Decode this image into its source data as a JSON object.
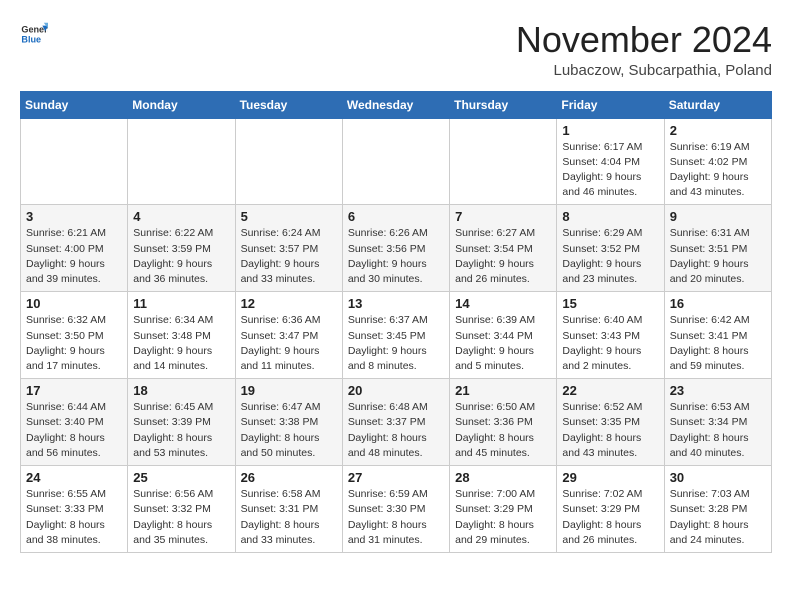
{
  "header": {
    "logo_general": "General",
    "logo_blue": "Blue",
    "month_title": "November 2024",
    "location": "Lubaczow, Subcarpathia, Poland"
  },
  "weekdays": [
    "Sunday",
    "Monday",
    "Tuesday",
    "Wednesday",
    "Thursday",
    "Friday",
    "Saturday"
  ],
  "weeks": [
    [
      {
        "day": "",
        "detail": ""
      },
      {
        "day": "",
        "detail": ""
      },
      {
        "day": "",
        "detail": ""
      },
      {
        "day": "",
        "detail": ""
      },
      {
        "day": "",
        "detail": ""
      },
      {
        "day": "1",
        "detail": "Sunrise: 6:17 AM\nSunset: 4:04 PM\nDaylight: 9 hours\nand 46 minutes."
      },
      {
        "day": "2",
        "detail": "Sunrise: 6:19 AM\nSunset: 4:02 PM\nDaylight: 9 hours\nand 43 minutes."
      }
    ],
    [
      {
        "day": "3",
        "detail": "Sunrise: 6:21 AM\nSunset: 4:00 PM\nDaylight: 9 hours\nand 39 minutes."
      },
      {
        "day": "4",
        "detail": "Sunrise: 6:22 AM\nSunset: 3:59 PM\nDaylight: 9 hours\nand 36 minutes."
      },
      {
        "day": "5",
        "detail": "Sunrise: 6:24 AM\nSunset: 3:57 PM\nDaylight: 9 hours\nand 33 minutes."
      },
      {
        "day": "6",
        "detail": "Sunrise: 6:26 AM\nSunset: 3:56 PM\nDaylight: 9 hours\nand 30 minutes."
      },
      {
        "day": "7",
        "detail": "Sunrise: 6:27 AM\nSunset: 3:54 PM\nDaylight: 9 hours\nand 26 minutes."
      },
      {
        "day": "8",
        "detail": "Sunrise: 6:29 AM\nSunset: 3:52 PM\nDaylight: 9 hours\nand 23 minutes."
      },
      {
        "day": "9",
        "detail": "Sunrise: 6:31 AM\nSunset: 3:51 PM\nDaylight: 9 hours\nand 20 minutes."
      }
    ],
    [
      {
        "day": "10",
        "detail": "Sunrise: 6:32 AM\nSunset: 3:50 PM\nDaylight: 9 hours\nand 17 minutes."
      },
      {
        "day": "11",
        "detail": "Sunrise: 6:34 AM\nSunset: 3:48 PM\nDaylight: 9 hours\nand 14 minutes."
      },
      {
        "day": "12",
        "detail": "Sunrise: 6:36 AM\nSunset: 3:47 PM\nDaylight: 9 hours\nand 11 minutes."
      },
      {
        "day": "13",
        "detail": "Sunrise: 6:37 AM\nSunset: 3:45 PM\nDaylight: 9 hours\nand 8 minutes."
      },
      {
        "day": "14",
        "detail": "Sunrise: 6:39 AM\nSunset: 3:44 PM\nDaylight: 9 hours\nand 5 minutes."
      },
      {
        "day": "15",
        "detail": "Sunrise: 6:40 AM\nSunset: 3:43 PM\nDaylight: 9 hours\nand 2 minutes."
      },
      {
        "day": "16",
        "detail": "Sunrise: 6:42 AM\nSunset: 3:41 PM\nDaylight: 8 hours\nand 59 minutes."
      }
    ],
    [
      {
        "day": "17",
        "detail": "Sunrise: 6:44 AM\nSunset: 3:40 PM\nDaylight: 8 hours\nand 56 minutes."
      },
      {
        "day": "18",
        "detail": "Sunrise: 6:45 AM\nSunset: 3:39 PM\nDaylight: 8 hours\nand 53 minutes."
      },
      {
        "day": "19",
        "detail": "Sunrise: 6:47 AM\nSunset: 3:38 PM\nDaylight: 8 hours\nand 50 minutes."
      },
      {
        "day": "20",
        "detail": "Sunrise: 6:48 AM\nSunset: 3:37 PM\nDaylight: 8 hours\nand 48 minutes."
      },
      {
        "day": "21",
        "detail": "Sunrise: 6:50 AM\nSunset: 3:36 PM\nDaylight: 8 hours\nand 45 minutes."
      },
      {
        "day": "22",
        "detail": "Sunrise: 6:52 AM\nSunset: 3:35 PM\nDaylight: 8 hours\nand 43 minutes."
      },
      {
        "day": "23",
        "detail": "Sunrise: 6:53 AM\nSunset: 3:34 PM\nDaylight: 8 hours\nand 40 minutes."
      }
    ],
    [
      {
        "day": "24",
        "detail": "Sunrise: 6:55 AM\nSunset: 3:33 PM\nDaylight: 8 hours\nand 38 minutes."
      },
      {
        "day": "25",
        "detail": "Sunrise: 6:56 AM\nSunset: 3:32 PM\nDaylight: 8 hours\nand 35 minutes."
      },
      {
        "day": "26",
        "detail": "Sunrise: 6:58 AM\nSunset: 3:31 PM\nDaylight: 8 hours\nand 33 minutes."
      },
      {
        "day": "27",
        "detail": "Sunrise: 6:59 AM\nSunset: 3:30 PM\nDaylight: 8 hours\nand 31 minutes."
      },
      {
        "day": "28",
        "detail": "Sunrise: 7:00 AM\nSunset: 3:29 PM\nDaylight: 8 hours\nand 29 minutes."
      },
      {
        "day": "29",
        "detail": "Sunrise: 7:02 AM\nSunset: 3:29 PM\nDaylight: 8 hours\nand 26 minutes."
      },
      {
        "day": "30",
        "detail": "Sunrise: 7:03 AM\nSunset: 3:28 PM\nDaylight: 8 hours\nand 24 minutes."
      }
    ]
  ]
}
